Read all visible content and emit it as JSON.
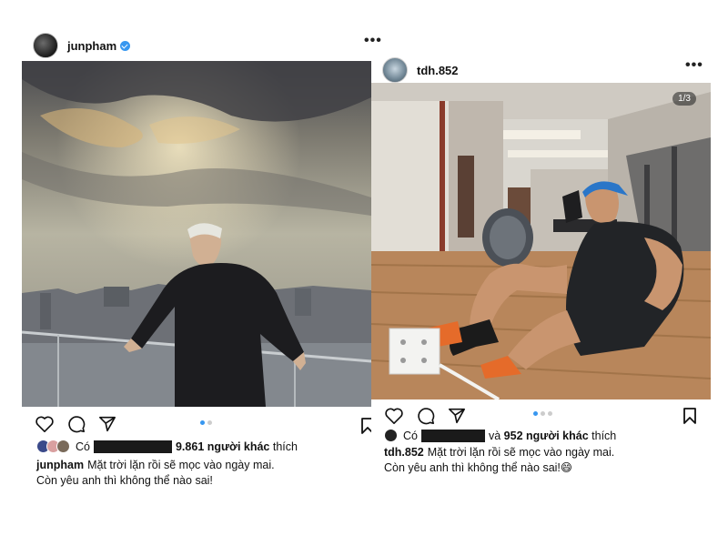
{
  "left_post": {
    "username": "junpham",
    "likes_prefix": "Có",
    "likes_count": "9.861 người khác",
    "likes_suffix": "thích",
    "caption_user": "junpham",
    "caption_line1": "Mặt trời lặn rồi sẽ mọc vào ngày mai.",
    "caption_line2": "Còn yêu anh thì không thể nào sai!"
  },
  "right_post": {
    "username": "tdh.852",
    "slide_counter": "1/3",
    "likes_prefix": "Có",
    "likes_mid": "và",
    "likes_count": "952 người khác",
    "likes_suffix": "thích",
    "caption_user": "tdh.852",
    "caption_line1": "Mặt trời lặn rồi sẽ mọc vào ngày mai.",
    "caption_line2": "Còn yêu anh thì không thể nào sai!😄"
  },
  "colors": {
    "verified": "#3897f0",
    "active_dot": "#3897f0",
    "censor_bar": "#1a1a1a"
  },
  "icons": [
    "more-icon",
    "heart-icon",
    "comment-icon",
    "share-icon",
    "bookmark-icon",
    "verified-icon"
  ]
}
